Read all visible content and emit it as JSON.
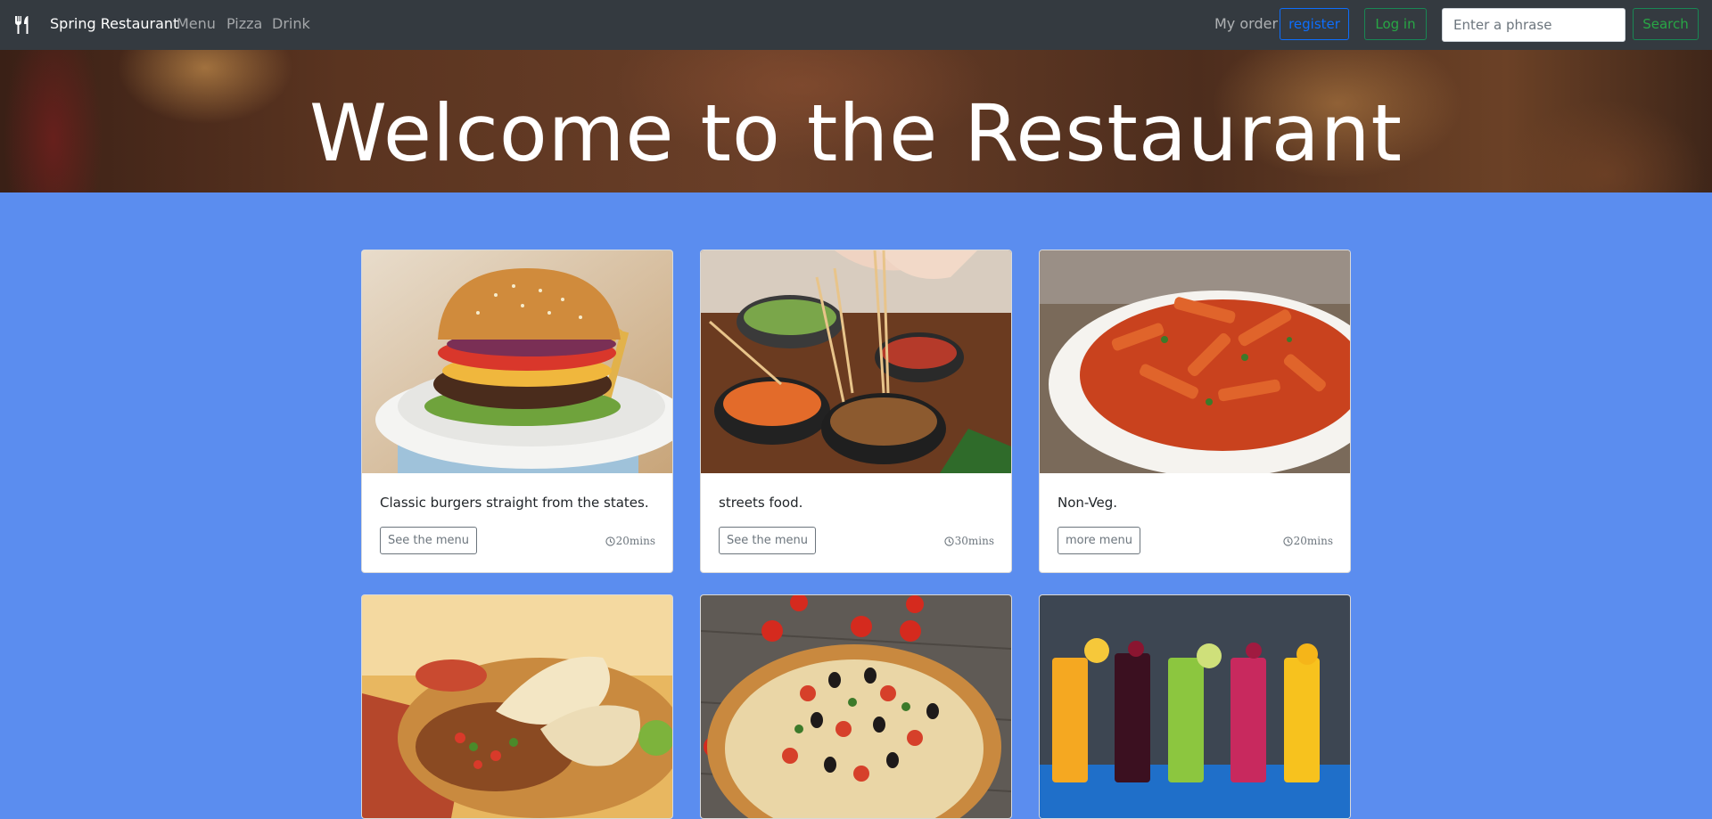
{
  "navbar": {
    "brand_icon": "utensils-icon",
    "brand": "Spring Restaurant",
    "links": [
      "Menu",
      "Pizza",
      "Drink"
    ],
    "my_order": "My order",
    "register": "register",
    "login": "Log in",
    "search_placeholder": "Enter a phrase",
    "search_button": "Search",
    "colors": {
      "bg": "#343a40",
      "primary": "#0d6efd",
      "success": "#28a745"
    }
  },
  "hero": {
    "title": "Welcome to the Restaurant"
  },
  "page": {
    "background": "#5b8def"
  },
  "cards": [
    {
      "image": "burger-photo",
      "text": "Classic burgers straight from the states.",
      "button": "See the menu",
      "time": "20mins",
      "time_icon": "clock-icon"
    },
    {
      "image": "street-food-photo",
      "text": "streets food.",
      "button": "See the menu",
      "time": "30mins",
      "time_icon": "clock-icon"
    },
    {
      "image": "pasta-photo",
      "text": "Non-Veg.",
      "button": "more menu",
      "time": "20mins",
      "time_icon": "clock-icon"
    },
    {
      "image": "burrito-photo"
    },
    {
      "image": "pizza-photo"
    },
    {
      "image": "drinks-photo"
    }
  ]
}
